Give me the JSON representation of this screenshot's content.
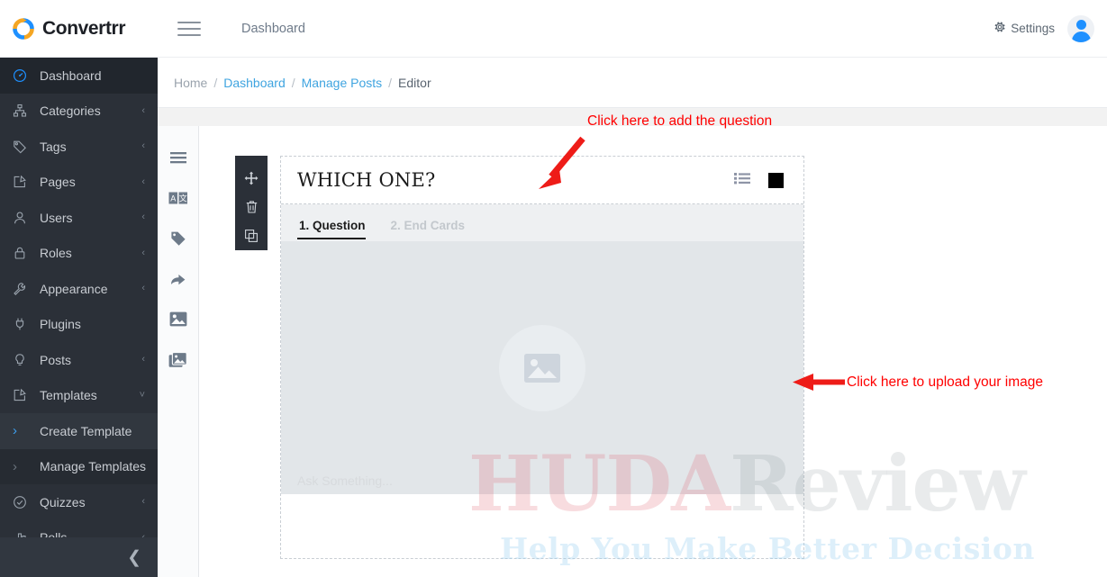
{
  "brand": {
    "name": "Convertrr",
    "logo_icon": "circular-arrows-logo"
  },
  "topbar": {
    "menu_icon": "hamburger-menu-icon",
    "page_title": "Dashboard",
    "settings_label": "Settings",
    "settings_icon": "gear-icon",
    "avatar_icon": "user-avatar-icon"
  },
  "sidebar": {
    "collapse_icon": "chevron-left-icon",
    "items": [
      {
        "label": "Dashboard",
        "icon": "speedometer-icon",
        "caret": "",
        "state": "active"
      },
      {
        "label": "Categories",
        "icon": "sitemap-icon",
        "caret": "‹",
        "state": "normal"
      },
      {
        "label": "Tags",
        "icon": "tag-icon",
        "caret": "‹",
        "state": "normal"
      },
      {
        "label": "Pages",
        "icon": "page-edit-icon",
        "caret": "‹",
        "state": "normal"
      },
      {
        "label": "Users",
        "icon": "user-icon",
        "caret": "‹",
        "state": "normal"
      },
      {
        "label": "Roles",
        "icon": "lock-icon",
        "caret": "‹",
        "state": "normal"
      },
      {
        "label": "Appearance",
        "icon": "wrench-icon",
        "caret": "‹",
        "state": "normal"
      },
      {
        "label": "Plugins",
        "icon": "plug-icon",
        "caret": "",
        "state": "normal"
      },
      {
        "label": "Posts",
        "icon": "bulb-icon",
        "caret": "‹",
        "state": "normal"
      },
      {
        "label": "Templates",
        "icon": "page-edit-icon",
        "caret": "˅",
        "state": "open"
      },
      {
        "label": "Create Template",
        "icon": "chevron-right-icon",
        "caret": "",
        "state": "sub"
      },
      {
        "label": "Manage Templates",
        "icon": "chevron-right-icon",
        "caret": "",
        "state": "sub2"
      },
      {
        "label": "Quizzes",
        "icon": "check-circle-icon",
        "caret": "‹",
        "state": "normal"
      },
      {
        "label": "Polls",
        "icon": "bar-chart-icon",
        "caret": "‹",
        "state": "normal"
      }
    ]
  },
  "breadcrumb": {
    "items": [
      {
        "label": "Home",
        "type": "plain"
      },
      {
        "label": "Dashboard",
        "type": "link"
      },
      {
        "label": "Manage Posts",
        "type": "link"
      },
      {
        "label": "Editor",
        "type": "last"
      }
    ],
    "separator": "/"
  },
  "tool_rail": {
    "icons": [
      "list-lines-icon",
      "translate-icon",
      "tag-icon",
      "share-arrow-icon",
      "image-icon",
      "gallery-icon"
    ]
  },
  "card_rail": {
    "icons": [
      "move-icon",
      "trash-icon",
      "duplicate-icon"
    ]
  },
  "question_card": {
    "title": "WHICH ONE?",
    "title_placeholder": "WHICH ONE?",
    "list_icon": "bullet-list-icon",
    "swatch_icon": "color-swatch-icon",
    "swatch_color": "#000000",
    "tabs": [
      {
        "label": "1. Question",
        "active": true
      },
      {
        "label": "2. End Cards",
        "active": false
      }
    ],
    "image_drop": {
      "icon": "image-placeholder-icon",
      "bg_color": "#e2e6e9"
    },
    "ask_placeholder": "Ask Something..."
  },
  "annotations": [
    {
      "text": "Click here to add the question",
      "color": "#ff0000",
      "arrow": "arrow-down-left"
    },
    {
      "text": "Click here to upload your image",
      "color": "#ff0000",
      "arrow": "arrow-left"
    }
  ],
  "watermark": {
    "part1": "HUDA",
    "part2": "Review",
    "tagline": "Help You Make Better Decision"
  }
}
